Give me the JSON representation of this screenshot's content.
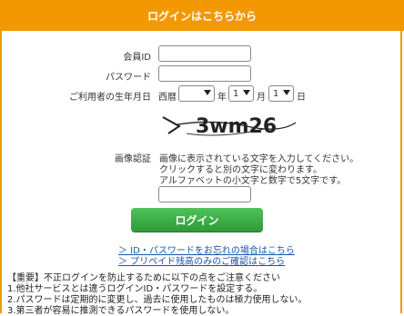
{
  "header": {
    "title": "ログインはこちらから"
  },
  "form": {
    "member_id_label": "会員ID",
    "member_id_value": "",
    "password_label": "パスワード",
    "password_value": "",
    "birthdate_label": "ご利用者の生年月日",
    "era_label": "西暦",
    "year_value": "",
    "year_suffix": "年",
    "month_value": "1",
    "month_suffix": "月",
    "day_value": "1",
    "day_suffix": "日",
    "captcha_label": "画像認証",
    "captcha_text": "3wm26",
    "captcha_help_1": "画像に表示されている文字を入力してください。",
    "captcha_help_2": "クリックすると別の文字に変わります。",
    "captcha_help_3": "アルファベットの小文字と数字で5文字です。",
    "captcha_input_value": "",
    "login_button": "ログイン"
  },
  "links": {
    "forgot": "＞ ID・パスワードをお忘れの場合はこちら",
    "prepaid": "＞ プリペイド残高のみのご確認はこちら"
  },
  "notes": {
    "line_1": "【重要】不正ログインを防止するために以下の点をご注意ください",
    "line_2": "1.他社サービスとは違うログインID・パスワードを設定する。",
    "line_3": "2.パスワードは定期的に変更し、過去に使用したものは極力使用しない。",
    "line_4": "3.第三者が容易に推測できるパスワードを使用しない。"
  },
  "colors": {
    "header": "#f39800",
    "button": "#36a843",
    "link": "#1a55a6"
  }
}
